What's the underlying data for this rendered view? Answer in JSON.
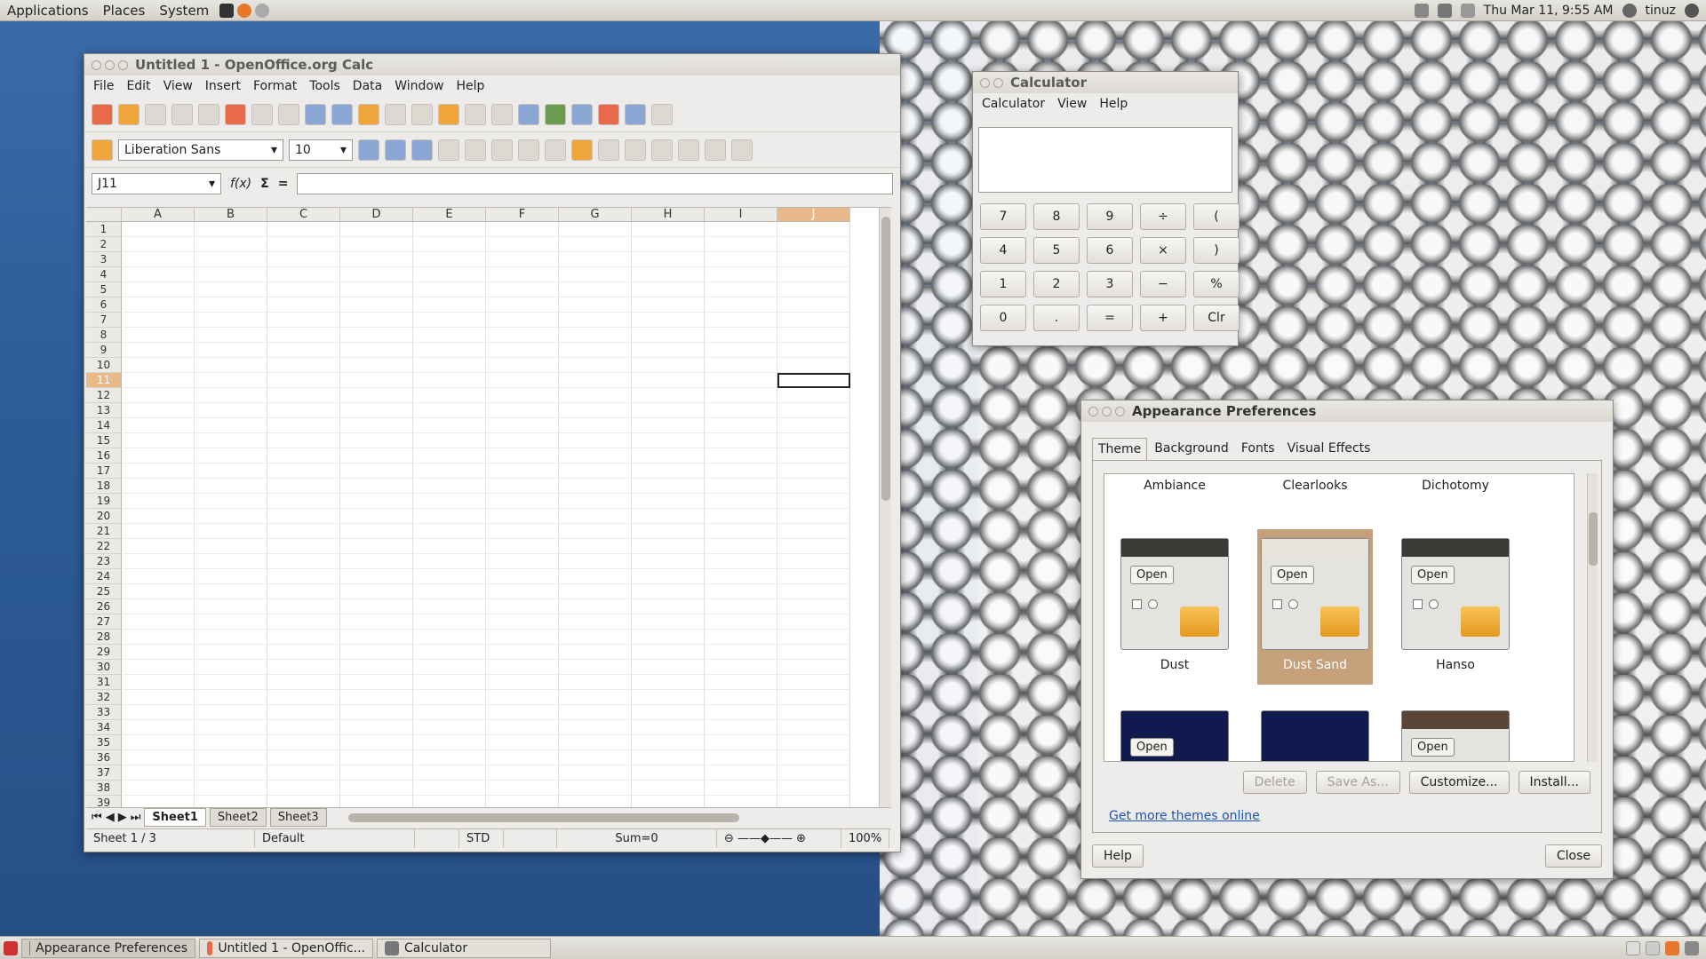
{
  "top_panel": {
    "menus": [
      "Applications",
      "Places",
      "System"
    ],
    "clock": "Thu Mar 11,  9:55 AM",
    "user": "tinuz"
  },
  "bottom_panel": {
    "tasks": [
      "Appearance Preferences",
      "Untitled 1 - OpenOffic...",
      "Calculator"
    ]
  },
  "calc": {
    "title": "Untitled 1 - OpenOffice.org Calc",
    "menu": [
      "File",
      "Edit",
      "View",
      "Insert",
      "Format",
      "Tools",
      "Data",
      "Window",
      "Help"
    ],
    "font_name": "Liberation Sans",
    "font_size": "10",
    "name_box": "J11",
    "columns": [
      "A",
      "B",
      "C",
      "D",
      "E",
      "F",
      "G",
      "H",
      "I",
      "J"
    ],
    "selected_column": "J",
    "rows": [
      "1",
      "2",
      "3",
      "4",
      "5",
      "6",
      "7",
      "8",
      "9",
      "10",
      "11",
      "12",
      "13",
      "14",
      "15",
      "16",
      "17",
      "18",
      "19",
      "20",
      "21",
      "22",
      "23",
      "24",
      "25",
      "26",
      "27",
      "28",
      "29",
      "30",
      "31",
      "32",
      "33",
      "34",
      "35",
      "36",
      "37",
      "38",
      "39"
    ],
    "selected_row": "11",
    "sheets": [
      "Sheet1",
      "Sheet2",
      "Sheet3"
    ],
    "status": {
      "sheet": "Sheet 1 / 3",
      "style": "Default",
      "mode": "STD",
      "sum": "Sum=0",
      "zoom": "100%"
    }
  },
  "calculator": {
    "title": "Calculator",
    "menu": [
      "Calculator",
      "View",
      "Help"
    ],
    "keys": [
      "7",
      "8",
      "9",
      "÷",
      "(",
      "4",
      "5",
      "6",
      "×",
      ")",
      "1",
      "2",
      "3",
      "−",
      "%",
      "0",
      ".",
      "=",
      "+",
      "Clr"
    ]
  },
  "appearance": {
    "title": "Appearance Preferences",
    "tabs": [
      "Theme",
      "Background",
      "Fonts",
      "Visual Effects"
    ],
    "active_tab": "Theme",
    "themes_top": [
      "Ambiance",
      "Clearlooks",
      "Dichotomy"
    ],
    "themes_mid": [
      "Dust",
      "Dust Sand",
      "Hanso"
    ],
    "selected_theme": "Dust Sand",
    "open_label": "Open",
    "buttons": {
      "delete": "Delete",
      "save_as": "Save As...",
      "customize": "Customize...",
      "install": "Install..."
    },
    "link": "Get more themes online",
    "help": "Help",
    "close": "Close"
  }
}
